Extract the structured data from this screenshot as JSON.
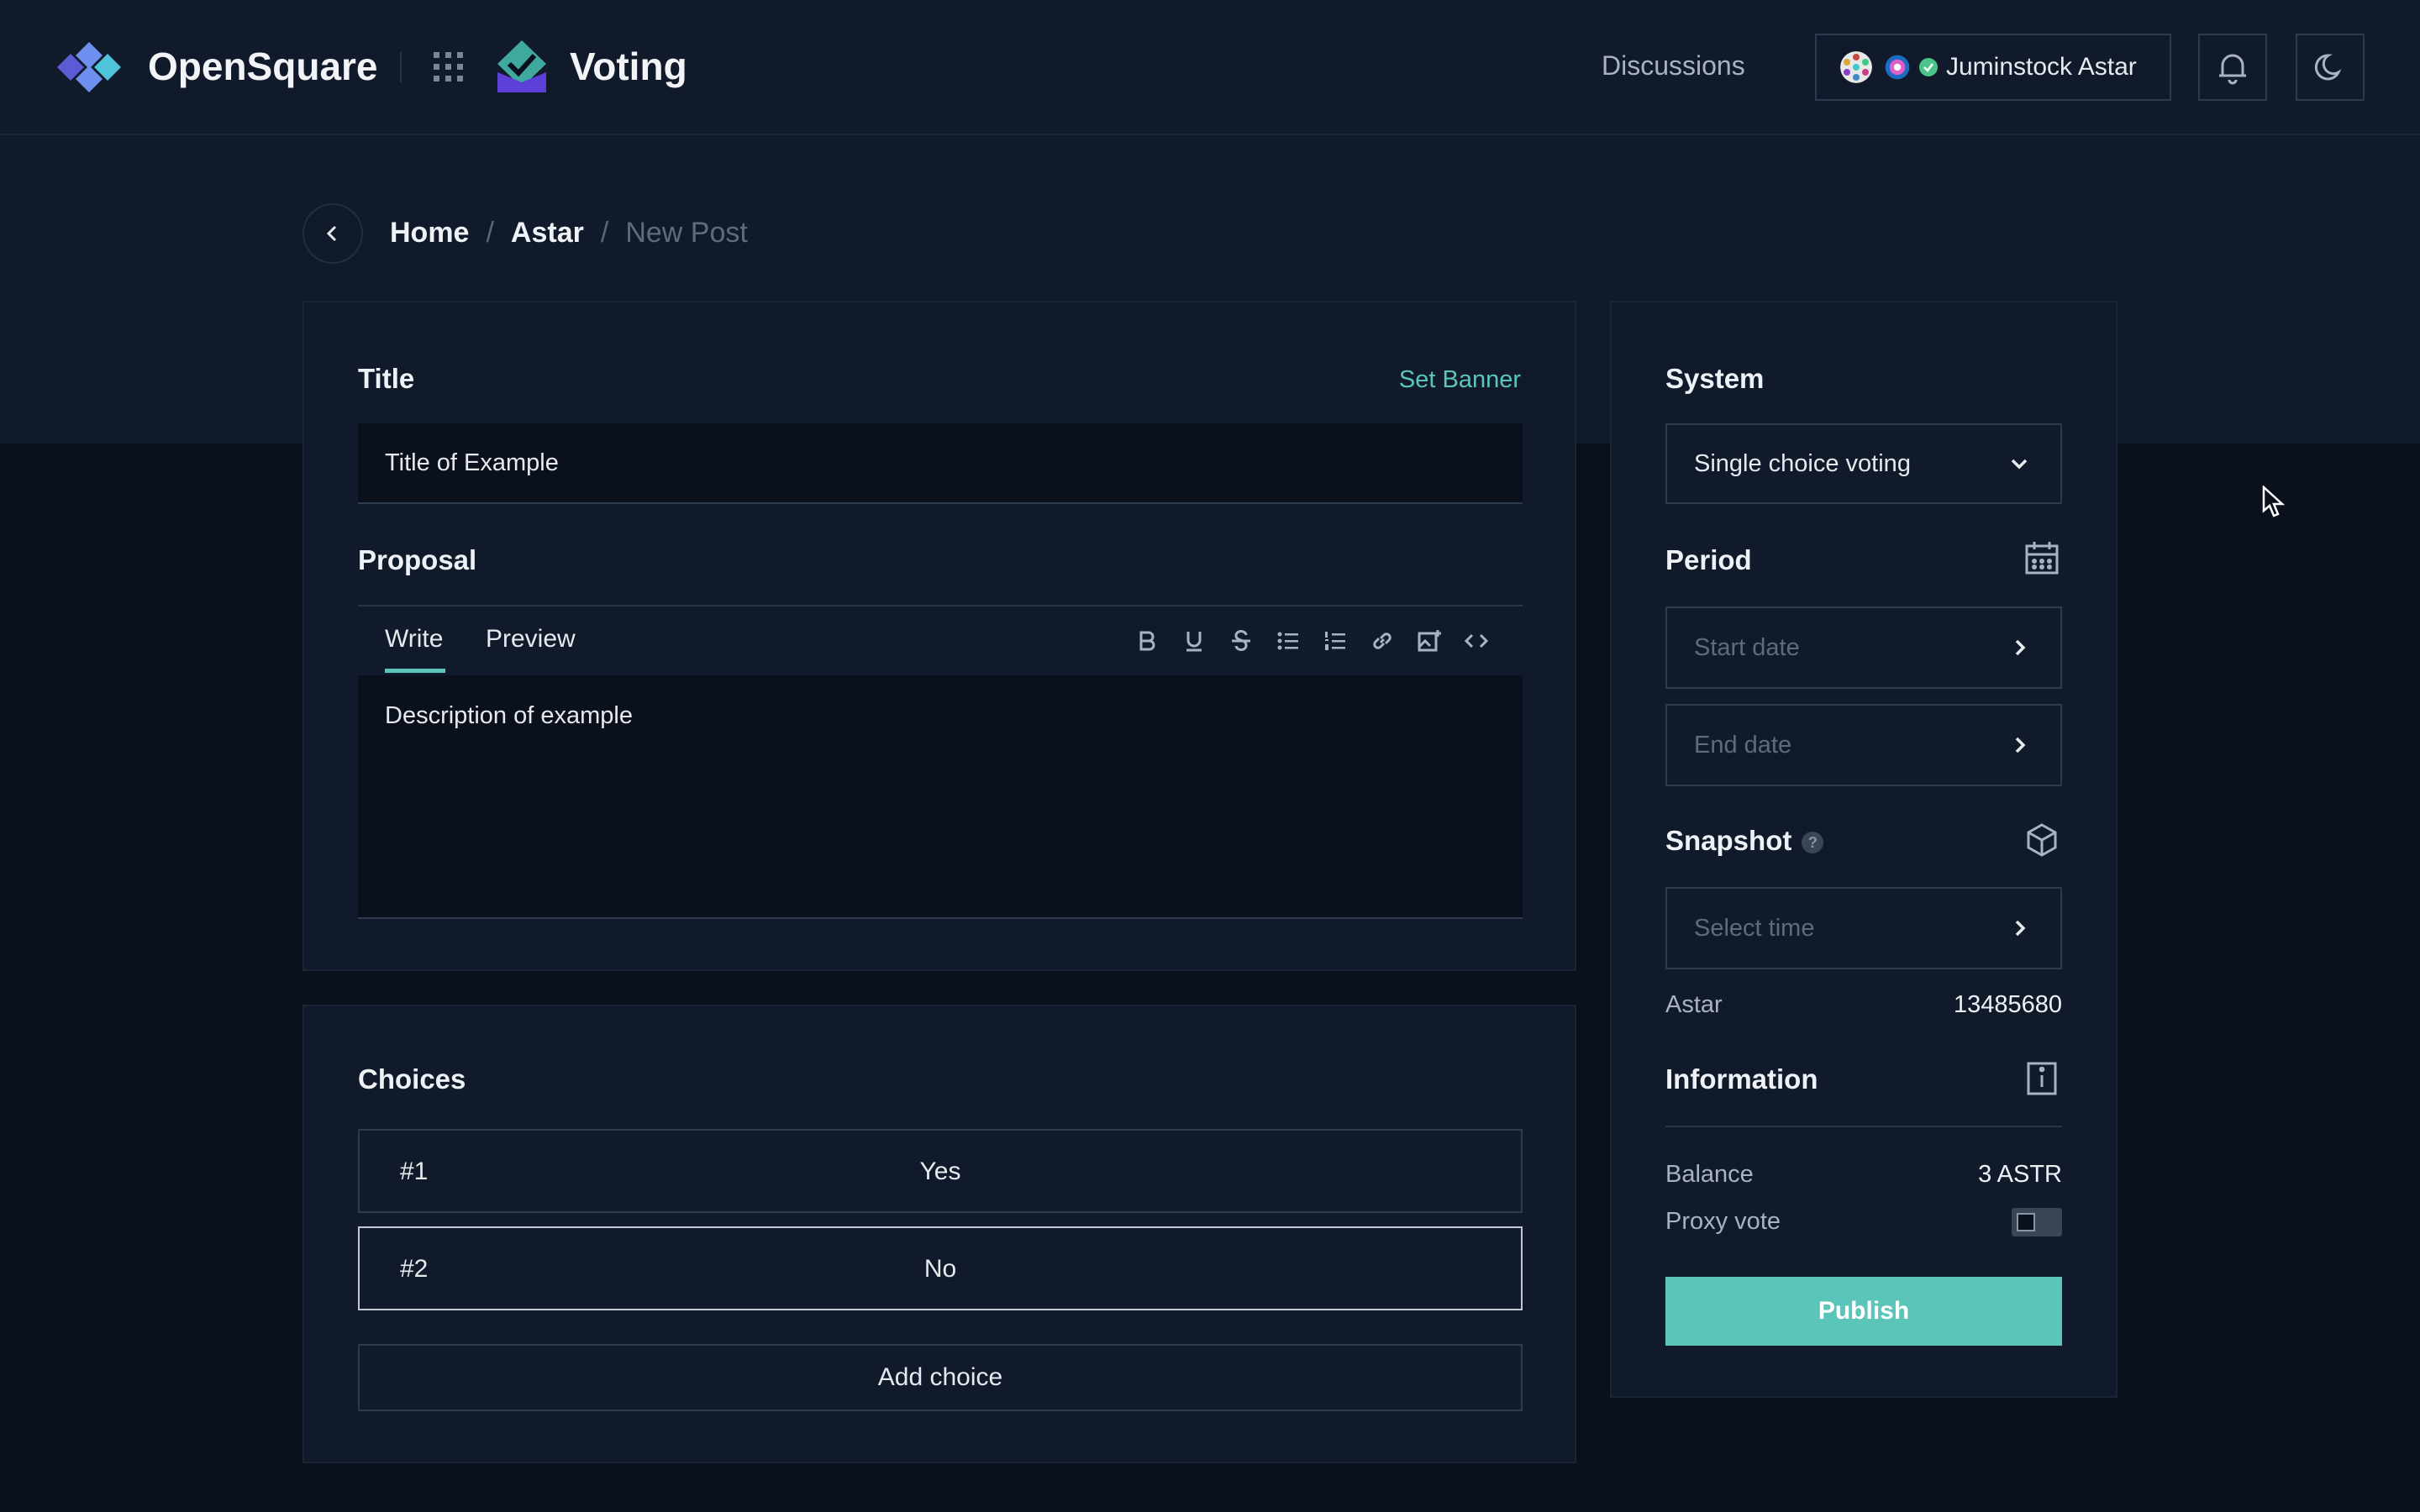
{
  "header": {
    "brand": "OpenSquare",
    "app": "Voting",
    "nav_discussions": "Discussions",
    "account_name": "Juminstock Astar"
  },
  "breadcrumb": {
    "home": "Home",
    "space": "Astar",
    "current": "New Post",
    "sep": "/"
  },
  "editor": {
    "title_label": "Title",
    "set_banner": "Set Banner",
    "title_value": "Title of Example",
    "proposal_label": "Proposal",
    "tab_write": "Write",
    "tab_preview": "Preview",
    "description": "Description of example"
  },
  "choices": {
    "label": "Choices",
    "items": [
      {
        "num": "#1",
        "value": "Yes"
      },
      {
        "num": "#2",
        "value": "No"
      }
    ],
    "add_label": "Add choice"
  },
  "sidebar": {
    "system_label": "System",
    "system_value": "Single choice voting",
    "period_label": "Period",
    "start_placeholder": "Start date",
    "end_placeholder": "End date",
    "snapshot_label": "Snapshot",
    "snapshot_help": "?",
    "select_time": "Select time",
    "network": "Astar",
    "block_height": "13485680",
    "information_label": "Information",
    "balance_label": "Balance",
    "balance_value": "3 ASTR",
    "proxy_label": "Proxy vote",
    "proxy_enabled": false,
    "publish_label": "Publish"
  },
  "colors": {
    "accent": "#5cc5b9",
    "background": "#0b111c",
    "panel": "#111a2b"
  }
}
